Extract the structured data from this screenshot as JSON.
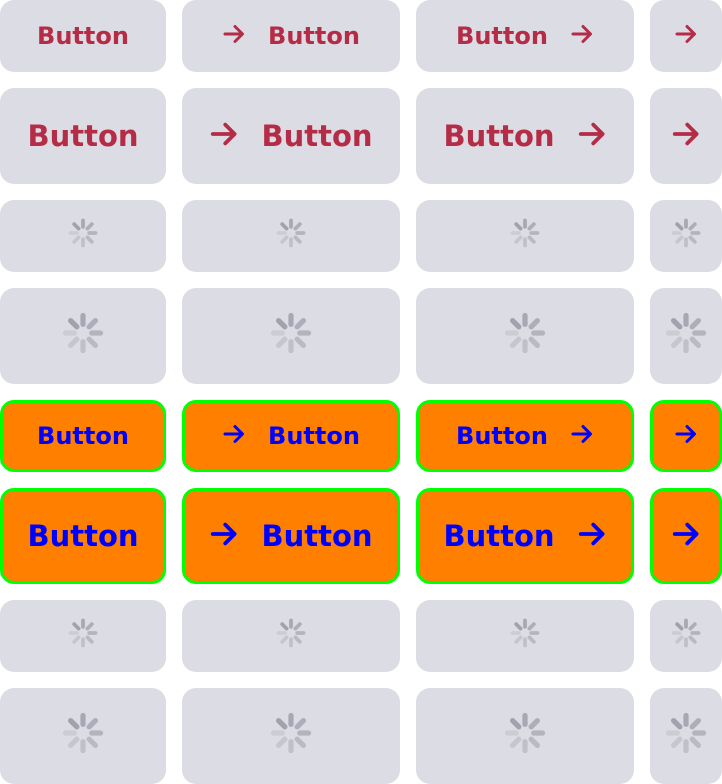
{
  "label": "Button",
  "icons": {
    "arrow": "arrow-right-icon",
    "spinner": "loading-spinner-icon"
  },
  "colors": {
    "default_bg": "#dcdce4",
    "default_text": "#b52c47",
    "custom_bg": "#ff7f00",
    "custom_text": "#0000ff",
    "custom_border": "#00ff00",
    "spinner": "#9d9daa"
  },
  "variants": [
    "text-only",
    "icon-left",
    "icon-right",
    "icon-only"
  ],
  "rows": [
    {
      "style": "default",
      "size": "small",
      "state": "normal"
    },
    {
      "style": "default",
      "size": "large",
      "state": "normal"
    },
    {
      "style": "default",
      "size": "small",
      "state": "loading"
    },
    {
      "style": "default",
      "size": "large",
      "state": "loading"
    },
    {
      "style": "custom",
      "size": "small",
      "state": "normal"
    },
    {
      "style": "custom",
      "size": "large",
      "state": "normal"
    },
    {
      "style": "default",
      "size": "small",
      "state": "loading"
    },
    {
      "style": "default",
      "size": "large",
      "state": "loading"
    }
  ]
}
